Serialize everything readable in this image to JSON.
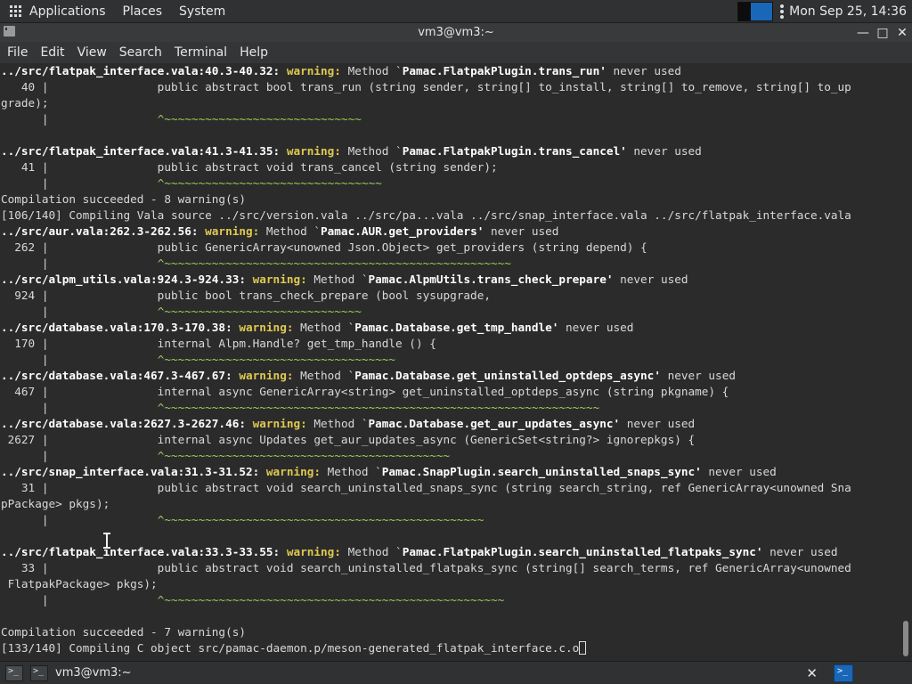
{
  "top_panel": {
    "menus": [
      "Applications",
      "Places",
      "System"
    ],
    "clock": "Mon Sep 25, 14:36",
    "icons": [
      "apps-grid-icon",
      "workspace-switcher-icon",
      "more-options-icon"
    ]
  },
  "window": {
    "title": "vm3@vm3:~",
    "controls": {
      "minimize": "—",
      "maximize": "□",
      "close": "✕"
    }
  },
  "menubar": [
    "File",
    "Edit",
    "View",
    "Search",
    "Terminal",
    "Help"
  ],
  "terminal_lines": [
    [
      {
        "t": "../src/flatpak_interface.vala:40.3-40.32: ",
        "c": "b"
      },
      {
        "t": "warning: ",
        "c": "w"
      },
      {
        "t": "Method `",
        "c": ""
      },
      {
        "t": "Pamac.FlatpakPlugin.trans_run'",
        "c": "b"
      },
      {
        "t": " never used",
        "c": ""
      }
    ],
    [
      {
        "t": "   40 |                public abstract bool trans_run (string sender, string[] to_install, string[] to_remove, string[] to_up",
        "c": ""
      }
    ],
    [
      {
        "t": "grade);",
        "c": ""
      }
    ],
    [
      {
        "t": "      |                ",
        "c": ""
      },
      {
        "t": "^~~~~~~~~~~~~~~~~~~~~~~~~~~~~~",
        "c": "g"
      }
    ],
    [
      {
        "t": "",
        "c": ""
      }
    ],
    [
      {
        "t": "../src/flatpak_interface.vala:41.3-41.35: ",
        "c": "b"
      },
      {
        "t": "warning: ",
        "c": "w"
      },
      {
        "t": "Method `",
        "c": ""
      },
      {
        "t": "Pamac.FlatpakPlugin.trans_cancel'",
        "c": "b"
      },
      {
        "t": " never used",
        "c": ""
      }
    ],
    [
      {
        "t": "   41 |                public abstract void trans_cancel (string sender);",
        "c": ""
      }
    ],
    [
      {
        "t": "      |                ",
        "c": ""
      },
      {
        "t": "^~~~~~~~~~~~~~~~~~~~~~~~~~~~~~~~~",
        "c": "g"
      }
    ],
    [
      {
        "t": "Compilation succeeded - 8 warning(s)",
        "c": ""
      }
    ],
    [
      {
        "t": "[106/140] Compiling Vala source ../src/version.vala ../src/pa...vala ../src/snap_interface.vala ../src/flatpak_interface.vala",
        "c": ""
      }
    ],
    [
      {
        "t": "../src/aur.vala:262.3-262.56: ",
        "c": "b"
      },
      {
        "t": "warning: ",
        "c": "w"
      },
      {
        "t": "Method `",
        "c": ""
      },
      {
        "t": "Pamac.AUR.get_providers'",
        "c": "b"
      },
      {
        "t": " never used",
        "c": ""
      }
    ],
    [
      {
        "t": "  262 |                public GenericArray<unowned Json.Object> get_providers (string depend) {",
        "c": ""
      }
    ],
    [
      {
        "t": "      |                ",
        "c": ""
      },
      {
        "t": "^~~~~~~~~~~~~~~~~~~~~~~~~~~~~~~~~~~~~~~~~~~~~~~~~~~~",
        "c": "g"
      }
    ],
    [
      {
        "t": "../src/alpm_utils.vala:924.3-924.33: ",
        "c": "b"
      },
      {
        "t": "warning: ",
        "c": "w"
      },
      {
        "t": "Method `",
        "c": ""
      },
      {
        "t": "Pamac.AlpmUtils.trans_check_prepare'",
        "c": "b"
      },
      {
        "t": " never used",
        "c": ""
      }
    ],
    [
      {
        "t": "  924 |                public bool trans_check_prepare (bool sysupgrade,",
        "c": ""
      }
    ],
    [
      {
        "t": "      |                ",
        "c": ""
      },
      {
        "t": "^~~~~~~~~~~~~~~~~~~~~~~~~~~~~~",
        "c": "g"
      }
    ],
    [
      {
        "t": "../src/database.vala:170.3-170.38: ",
        "c": "b"
      },
      {
        "t": "warning: ",
        "c": "w"
      },
      {
        "t": "Method `",
        "c": ""
      },
      {
        "t": "Pamac.Database.get_tmp_handle'",
        "c": "b"
      },
      {
        "t": " never used",
        "c": ""
      }
    ],
    [
      {
        "t": "  170 |                internal Alpm.Handle? get_tmp_handle () {",
        "c": ""
      }
    ],
    [
      {
        "t": "      |                ",
        "c": ""
      },
      {
        "t": "^~~~~~~~~~~~~~~~~~~~~~~~~~~~~~~~~~~",
        "c": "g"
      }
    ],
    [
      {
        "t": "../src/database.vala:467.3-467.67: ",
        "c": "b"
      },
      {
        "t": "warning: ",
        "c": "w"
      },
      {
        "t": "Method `",
        "c": ""
      },
      {
        "t": "Pamac.Database.get_uninstalled_optdeps_async'",
        "c": "b"
      },
      {
        "t": " never used",
        "c": ""
      }
    ],
    [
      {
        "t": "  467 |                internal async GenericArray<string> get_uninstalled_optdeps_async (string pkgname) {",
        "c": ""
      }
    ],
    [
      {
        "t": "      |                ",
        "c": ""
      },
      {
        "t": "^~~~~~~~~~~~~~~~~~~~~~~~~~~~~~~~~~~~~~~~~~~~~~~~~~~~~~~~~~~~~~~~~",
        "c": "g"
      }
    ],
    [
      {
        "t": "../src/database.vala:2627.3-2627.46: ",
        "c": "b"
      },
      {
        "t": "warning: ",
        "c": "w"
      },
      {
        "t": "Method `",
        "c": ""
      },
      {
        "t": "Pamac.Database.get_aur_updates_async'",
        "c": "b"
      },
      {
        "t": " never used",
        "c": ""
      }
    ],
    [
      {
        "t": " 2627 |                internal async Updates get_aur_updates_async (GenericSet<string?> ignorepkgs) {",
        "c": ""
      }
    ],
    [
      {
        "t": "      |                ",
        "c": ""
      },
      {
        "t": "^~~~~~~~~~~~~~~~~~~~~~~~~~~~~~~~~~~~~~~~~~~",
        "c": "g"
      }
    ],
    [
      {
        "t": "../src/snap_interface.vala:31.3-31.52: ",
        "c": "b"
      },
      {
        "t": "warning: ",
        "c": "w"
      },
      {
        "t": "Method `",
        "c": ""
      },
      {
        "t": "Pamac.SnapPlugin.search_uninstalled_snaps_sync'",
        "c": "b"
      },
      {
        "t": " never used",
        "c": ""
      }
    ],
    [
      {
        "t": "   31 |                public abstract void search_uninstalled_snaps_sync (string search_string, ref GenericArray<unowned Sna",
        "c": ""
      }
    ],
    [
      {
        "t": "pPackage> pkgs);",
        "c": ""
      }
    ],
    [
      {
        "t": "      |                ",
        "c": ""
      },
      {
        "t": "^~~~~~~~~~~~~~~~~~~~~~~~~~~~~~~~~~~~~~~~~~~~~~~~",
        "c": "g"
      }
    ],
    [
      {
        "t": "",
        "c": ""
      }
    ],
    [
      {
        "t": "../src/flatpak_interface.vala:33.3-33.55: ",
        "c": "b"
      },
      {
        "t": "warning: ",
        "c": "w"
      },
      {
        "t": "Method `",
        "c": ""
      },
      {
        "t": "Pamac.FlatpakPlugin.search_uninstalled_flatpaks_sync'",
        "c": "b"
      },
      {
        "t": " never used",
        "c": ""
      }
    ],
    [
      {
        "t": "   33 |                public abstract void search_uninstalled_flatpaks_sync (string[] search_terms, ref GenericArray<unowned",
        "c": ""
      }
    ],
    [
      {
        "t": " FlatpakPackage> pkgs);",
        "c": ""
      }
    ],
    [
      {
        "t": "      |                ",
        "c": ""
      },
      {
        "t": "^~~~~~~~~~~~~~~~~~~~~~~~~~~~~~~~~~~~~~~~~~~~~~~~~~~",
        "c": "g"
      }
    ],
    [
      {
        "t": "",
        "c": ""
      }
    ],
    [
      {
        "t": "Compilation succeeded - 7 warning(s)",
        "c": ""
      }
    ],
    [
      {
        "t": "[133/140] Compiling C object src/pamac-daemon.p/meson-generated_flatpak_interface.c.o",
        "c": ""
      }
    ]
  ],
  "taskbar": {
    "task_title": "vm3@vm3:~",
    "close": "✕"
  },
  "colors": {
    "warning": "#e0c850",
    "caret": "#9bd15a",
    "background": "#2b2b2b",
    "workspace_active": "#1a67b8"
  }
}
